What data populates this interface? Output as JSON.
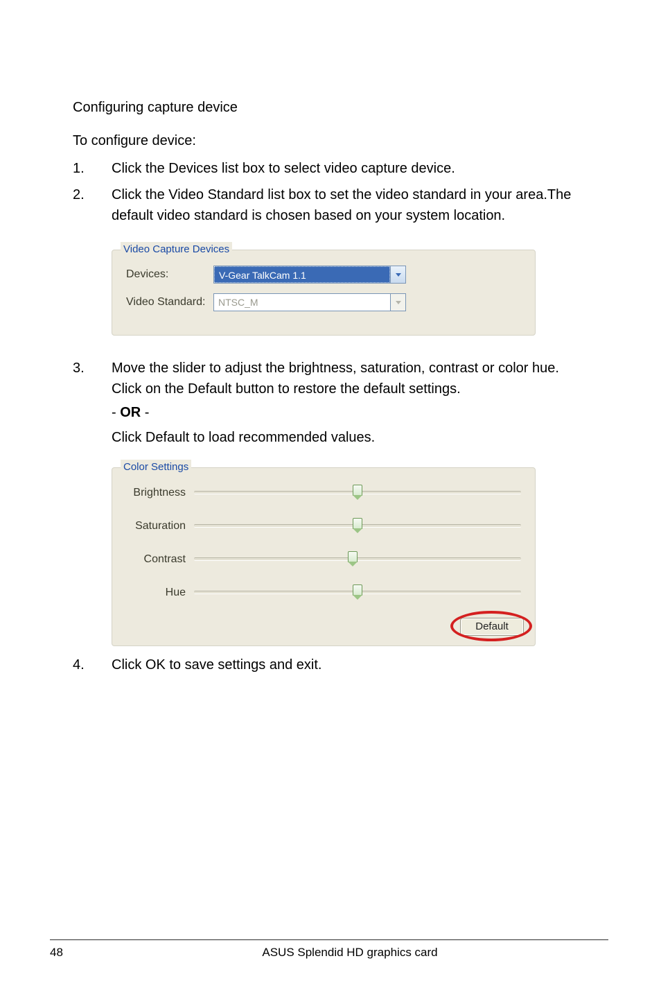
{
  "heading": "Configuring capture device",
  "intro": "To configure device:",
  "steps": {
    "s1": {
      "num": "1.",
      "text": "Click the Devices list box to select video capture device."
    },
    "s2": {
      "num": "2.",
      "text": "Click the Video Standard list box to set the video standard in your area.The default video standard is chosen based on your system location."
    },
    "s3": {
      "num": "3.",
      "text": "Move the slider to adjust the brightness, saturation, contrast or color hue. Click on the Default button to restore the default settings.",
      "or_prefix": "- ",
      "or_word": "OR",
      "or_suffix": " -",
      "alt": "Click Default to load recommended values."
    },
    "s4": {
      "num": "4.",
      "text": "Click OK to save settings and exit."
    }
  },
  "videoCapture": {
    "legend": "Video Capture Devices",
    "devicesLabel": "Devices:",
    "devicesValue": "V-Gear TalkCam 1.1",
    "stdLabel": "Video Standard:",
    "stdValue": "NTSC_M"
  },
  "colorSettings": {
    "legend": "Color Settings",
    "brightness": "Brightness",
    "saturation": "Saturation",
    "contrast": "Contrast",
    "hue": "Hue",
    "defaultLabel": "Default"
  },
  "footer": {
    "page": "48",
    "text": "ASUS Splendid HD graphics card"
  }
}
